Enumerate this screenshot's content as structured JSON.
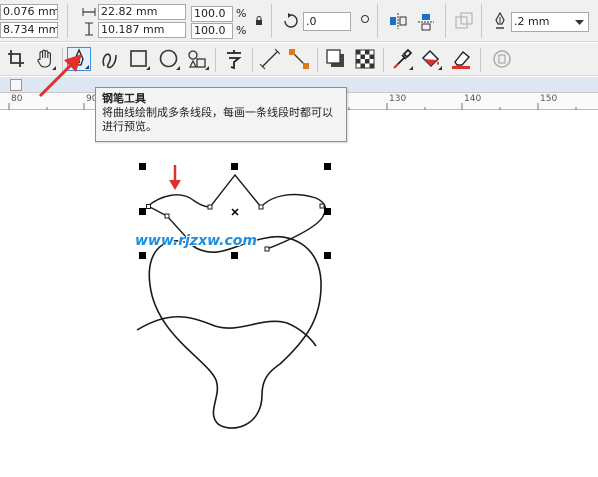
{
  "propbar": {
    "pos_x": "0.076 mm",
    "pos_y": "8.734 mm",
    "width": "22.82 mm",
    "height": "10.187 mm",
    "scale_x": "100.0",
    "scale_y": "100.0",
    "percent": "%",
    "rotation": ".0",
    "outline_width": ".2 mm"
  },
  "ruler": {
    "labels": [
      "80",
      "90",
      "130",
      "140",
      "150"
    ]
  },
  "tooltip": {
    "title": "钢笔工具",
    "description": "将曲线绘制成多条线段，每画一条线段时都可以进行预览。"
  },
  "watermark": "www.rjzxw.com",
  "colors": {
    "accent": "#e0302b",
    "tool_highlight": "#3a8ee6",
    "watermark": "#1a8fe0"
  }
}
